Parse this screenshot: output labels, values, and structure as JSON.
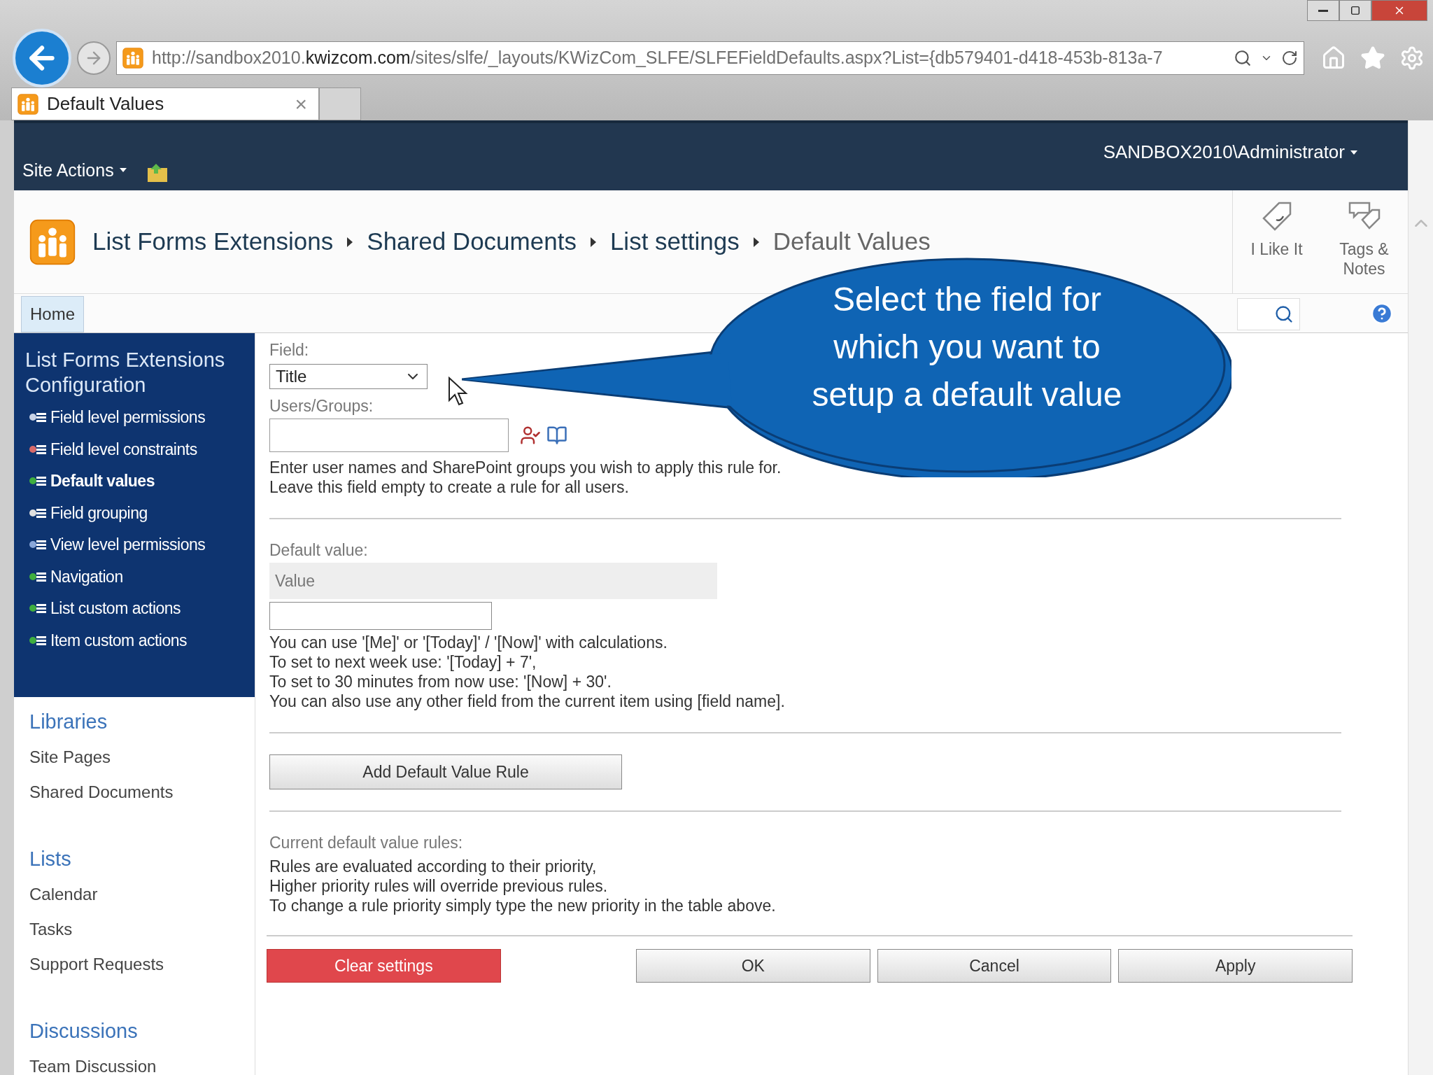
{
  "browser": {
    "url": "http://sandbox2010.**kwizcom.com**/sites/slfe/_layouts/KWizCom_SLFE/SLFEFieldDefaults.aspx?List={db579401-d418-453b-813a-7",
    "tabs": [
      {
        "title": "Default Values",
        "close": "×",
        "selected": true
      }
    ]
  },
  "ribbon": {
    "site_actions": "Site Actions",
    "user": "SANDBOX2010\\Administrator"
  },
  "breadcrumb": [
    "List Forms Extensions",
    "Shared Documents",
    "List settings",
    "Default Values"
  ],
  "social": [
    {
      "kind": "like",
      "label": "I Like It"
    },
    {
      "kind": "tags",
      "label": "Tags & Notes"
    }
  ],
  "tabs": [
    {
      "label": "Home",
      "selected": true
    }
  ],
  "config_nav": {
    "title": "List Forms Extensions Configuration",
    "items": [
      {
        "label": "Field level permissions",
        "selected": false
      },
      {
        "label": "Field level constraints",
        "selected": false
      },
      {
        "label": "Default values",
        "selected": true
      },
      {
        "label": "Field grouping",
        "selected": false
      },
      {
        "label": "View level permissions",
        "selected": false
      },
      {
        "label": "Navigation",
        "selected": false
      },
      {
        "label": "List custom actions",
        "selected": false
      },
      {
        "label": "Item custom actions",
        "selected": false
      }
    ]
  },
  "quick_launch": [
    {
      "heading": "Libraries",
      "items": [
        "Site Pages",
        "Shared Documents"
      ]
    },
    {
      "heading": "Lists",
      "items": [
        "Calendar",
        "Tasks",
        "Support Requests"
      ]
    },
    {
      "heading": "Discussions",
      "items": [
        "Team Discussion"
      ]
    }
  ],
  "form": {
    "field_label": "Field:",
    "field_value": "Title",
    "users_label": "Users/Groups:",
    "users_hint": [
      "Enter user names and SharePoint groups you wish to apply this rule for.",
      "Leave this field empty to create a rule for all users."
    ],
    "default_label": "Default value:",
    "value_header": "Value",
    "value_hint": [
      "You can use '[Me]' or '[Today]' / '[Now]' with calculations.",
      "To set to next week use: '[Today] + 7',",
      "To set to 30 minutes from now use: '[Now] + 30'.",
      "You can also use any other field from the current item using [field name]."
    ],
    "add_button": "Add Default Value Rule",
    "rules_label": "Current default value rules:",
    "rules_text": [
      "Rules are evaluated according to their priority,",
      "Higher priority rules will override previous rules.",
      "To change a rule priority simply type the new priority in the table above."
    ]
  },
  "buttons": [
    {
      "kind": "danger",
      "label": "Clear settings"
    },
    {
      "kind": "normal",
      "label": "OK"
    },
    {
      "kind": "normal",
      "label": "Cancel"
    },
    {
      "kind": "normal",
      "label": "Apply"
    }
  ],
  "callout": {
    "lines": [
      "Select the field for",
      "which you want to",
      "setup a default value"
    ]
  }
}
